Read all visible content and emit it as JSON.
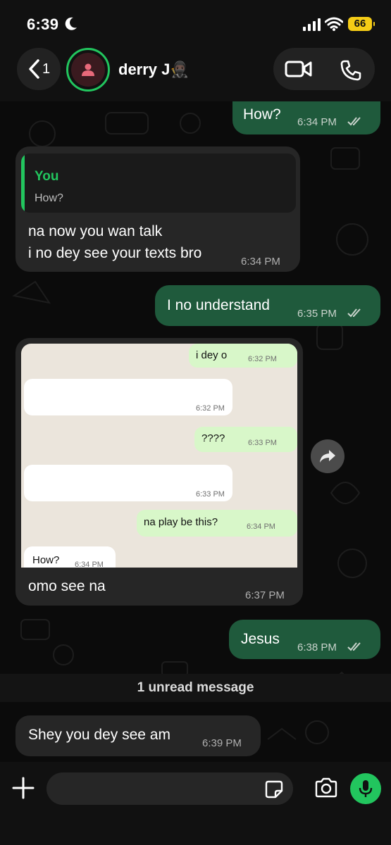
{
  "status_bar": {
    "time": "6:39",
    "battery": "66"
  },
  "header": {
    "back_count": "1",
    "contact_name": "derry J🥷🏿"
  },
  "messages": {
    "m1": {
      "text": "How?",
      "time": "6:34 PM"
    },
    "m2": {
      "quote_author": "You",
      "quote_text": "How?",
      "line1": "na now you wan talk",
      "line2": "i no dey see your texts bro",
      "time": "6:34 PM"
    },
    "m3": {
      "text": "I no understand",
      "time": "6:35 PM"
    },
    "m4": {
      "screenshot": {
        "b1": {
          "text": "i dey o",
          "time": "6:32 PM"
        },
        "b2": {
          "time": "6:32 PM"
        },
        "b3": {
          "text": "????",
          "time": "6:33 PM"
        },
        "b4": {
          "time": "6:33 PM"
        },
        "b5": {
          "text": "na play be this?",
          "time": "6:34 PM"
        },
        "b6": {
          "text": "How?",
          "time": "6:34 PM"
        }
      },
      "caption": "omo see na",
      "time": "6:37 PM"
    },
    "m5": {
      "text": "Jesus",
      "time": "6:38 PM"
    },
    "unread": "1 unread message",
    "m6": {
      "text": "Shey you dey see am",
      "time": "6:39 PM"
    }
  },
  "composer": {
    "placeholder": ""
  },
  "colors": {
    "accent": "#22c55e",
    "outgoing": "#1f5a3c",
    "incoming": "#262626",
    "background": "#0b0b0b"
  }
}
